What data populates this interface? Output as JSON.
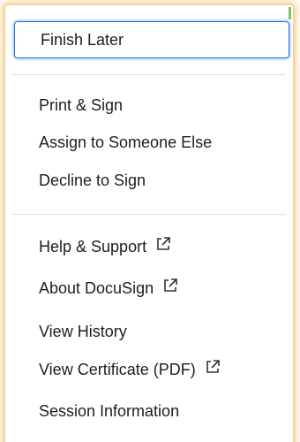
{
  "menu": {
    "focused_item": {
      "label": "Finish Later"
    },
    "group1": [
      {
        "label": "Print & Sign"
      },
      {
        "label": "Assign to Someone Else"
      },
      {
        "label": "Decline to Sign"
      }
    ],
    "group2": [
      {
        "label": "Help & Support",
        "icon": "external-link-icon"
      },
      {
        "label": "About DocuSign",
        "icon": "external-link-icon"
      },
      {
        "label": "View History"
      },
      {
        "label": "View Certificate (PDF)",
        "icon": "external-link-icon"
      },
      {
        "label": "Session Information"
      }
    ]
  },
  "colors": {
    "focus_ring": "#2a6fd6",
    "glow": "#f2b660",
    "text": "#1e1e1e",
    "divider": "#dedede"
  }
}
